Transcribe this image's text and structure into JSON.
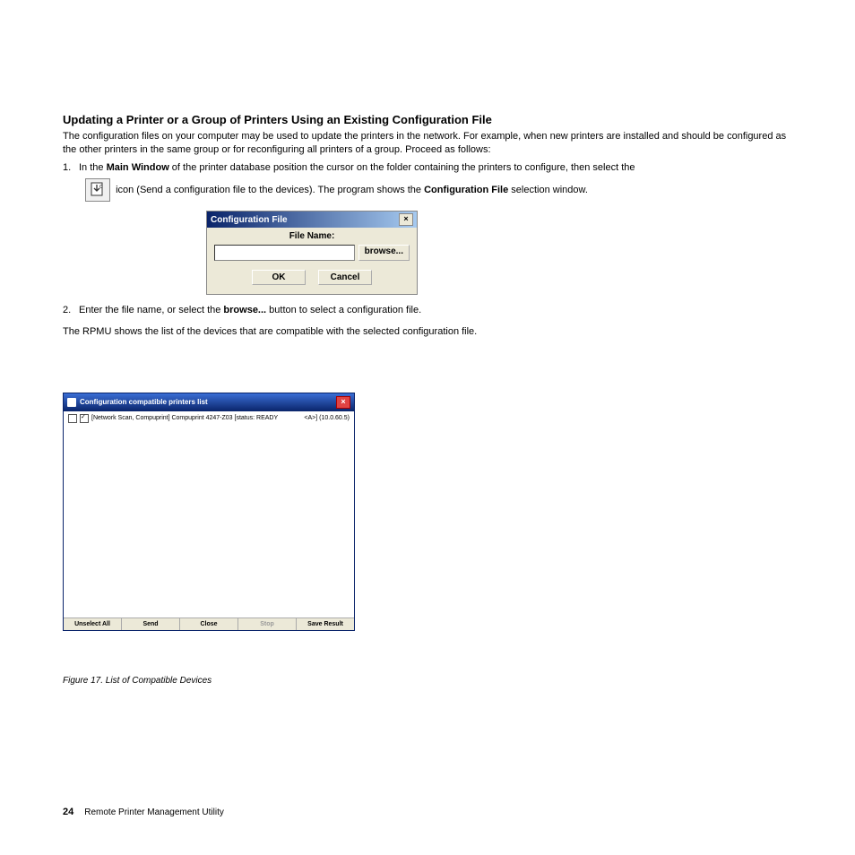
{
  "heading": "Updating a Printer or a Group of Printers Using an Existing Configuration File",
  "para1": "The configuration files on your computer may be used to update the printers in the network. For example, when new printers are installed and should be configured as the other printers in the same group or for reconfiguring all printers of a group. Proceed as follows:",
  "step1": {
    "num": "1.",
    "part1": "In the ",
    "bold1": "Main Window",
    "part2": " of the printer database position the cursor on the folder containing the printers to configure, then select the ",
    "part3": " icon (Send a configuration file to the devices). The program shows the ",
    "bold2": "Configuration File",
    "part4": " selection window."
  },
  "dialog1": {
    "title": "Configuration File",
    "label": "File Name:",
    "browse": "browse...",
    "ok": "OK",
    "cancel": "Cancel"
  },
  "step2": {
    "num": "2.",
    "part1": "Enter the file name, or select the ",
    "bold1": "browse...",
    "part2": " button to select a configuration file."
  },
  "para2": "The RPMU shows the list of the devices that are compatible with the selected configuration file.",
  "dialog2": {
    "title": "Configuration compatible printers list",
    "row": "[Network Scan, Compuprint] Compuprint 4247-Z03 [status: READY",
    "row_right": "<A>] (10.0.60.5)",
    "buttons": {
      "unselect": "Unselect All",
      "send": "Send",
      "close": "Close",
      "stop": "Stop",
      "save": "Save Result"
    }
  },
  "figcaption": "Figure 17. List of Compatible Devices",
  "footer": {
    "pagenum": "24",
    "title": "Remote Printer Management Utility"
  }
}
